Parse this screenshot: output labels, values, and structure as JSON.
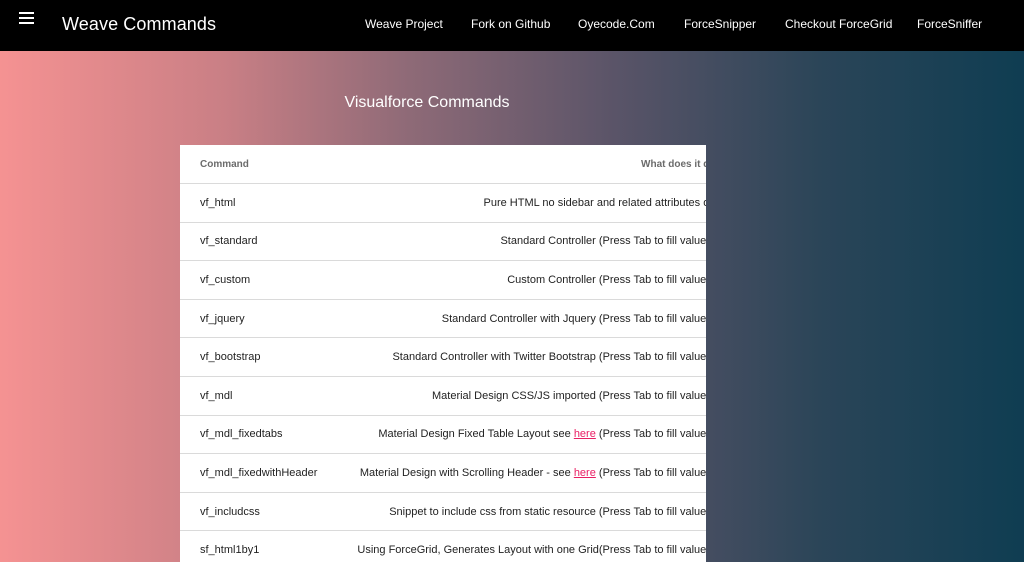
{
  "header": {
    "menu_icon": "hamburger-menu-icon",
    "title": "Weave Commands",
    "nav": [
      {
        "label": "Weave Project"
      },
      {
        "label": "Fork on Github"
      },
      {
        "label": "Oyecode.Com"
      },
      {
        "label": "ForceSnipper"
      },
      {
        "label": "Checkout ForceGrid"
      },
      {
        "label": "ForceSniffer"
      }
    ]
  },
  "main": {
    "section_title": "Visualforce Commands",
    "table": {
      "columns": [
        "Command",
        "What does it do"
      ],
      "rows": [
        {
          "command": "vf_html",
          "desc_pre": "Pure HTML no sidebar and related attributes on",
          "link": "",
          "desc_post": ""
        },
        {
          "command": "vf_standard",
          "desc_pre": "Standard Controller (Press Tab to fill values)",
          "link": "",
          "desc_post": ""
        },
        {
          "command": "vf_custom",
          "desc_pre": "Custom Controller (Press Tab to fill values)",
          "link": "",
          "desc_post": ""
        },
        {
          "command": "vf_jquery",
          "desc_pre": "Standard Controller with Jquery (Press Tab to fill values)",
          "link": "",
          "desc_post": ""
        },
        {
          "command": "vf_bootstrap",
          "desc_pre": "Standard Controller with Twitter Bootstrap (Press Tab to fill values)",
          "link": "",
          "desc_post": ""
        },
        {
          "command": "vf_mdl",
          "desc_pre": "Material Design CSS/JS imported (Press Tab to fill values)",
          "link": "",
          "desc_post": ""
        },
        {
          "command": "vf_mdl_fixedtabs",
          "desc_pre": "Material Design Fixed Table Layout see ",
          "link": "here",
          "desc_post": " (Press Tab to fill values)"
        },
        {
          "command": "vf_mdl_fixedwithHeader",
          "desc_pre": "Material Design with Scrolling Header - see ",
          "link": "here",
          "desc_post": " (Press Tab to fill values)"
        },
        {
          "command": "vf_includcss",
          "desc_pre": "Snippet to include css from static resource (Press Tab to fill values)",
          "link": "",
          "desc_post": ""
        },
        {
          "command": "sf_html1by1",
          "desc_pre": "Using ForceGrid, Generates Layout with one Grid(Press Tab to fill values)",
          "link": "",
          "desc_post": ""
        }
      ]
    }
  },
  "colors": {
    "header_bg": "#000000",
    "link": "#e91e63",
    "gradient_start": "#f59292",
    "gradient_end": "#0f3d52"
  }
}
